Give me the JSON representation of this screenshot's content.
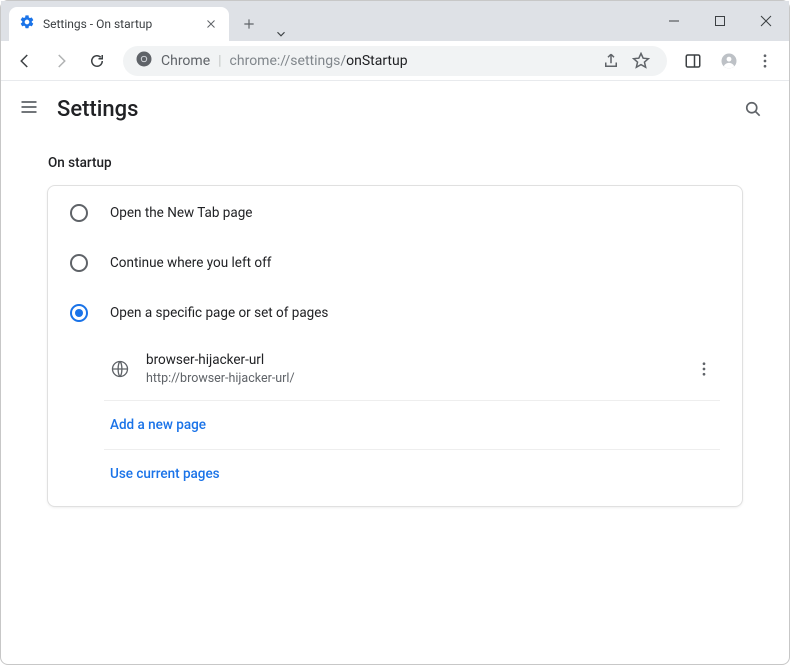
{
  "window": {
    "tab_title": "Settings - On startup"
  },
  "omnibox": {
    "app_label": "Chrome",
    "url_prefix": "chrome://settings/",
    "url_page": "onStartup"
  },
  "header": {
    "title": "Settings"
  },
  "section": {
    "title": "On startup"
  },
  "radios": [
    {
      "label": "Open the New Tab page",
      "checked": false
    },
    {
      "label": "Continue where you left off",
      "checked": false
    },
    {
      "label": "Open a specific page or set of pages",
      "checked": true
    }
  ],
  "pages": [
    {
      "title": "browser-hijacker-url",
      "url": "http://browser-hijacker-url/"
    }
  ],
  "actions": {
    "add": "Add a new page",
    "use_current": "Use current pages"
  }
}
